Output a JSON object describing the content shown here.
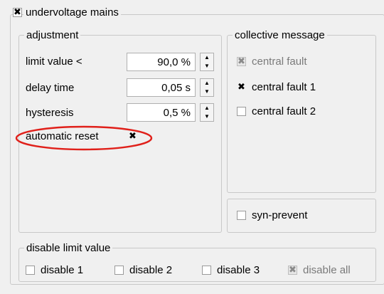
{
  "main_group": {
    "label": "undervoltage mains",
    "checked": true
  },
  "adjustment": {
    "label": "adjustment",
    "fields": [
      {
        "label": "limit value <",
        "value": "90,0 %"
      },
      {
        "label": "delay time",
        "value": "0,05 s"
      },
      {
        "label": "hysteresis",
        "value": "0,5 %"
      }
    ],
    "automatic_reset": {
      "label": "automatic reset",
      "checked": true
    }
  },
  "collective_message": {
    "label": "collective message",
    "items": [
      {
        "label": "central fault",
        "checked": true,
        "disabled": true
      },
      {
        "label": "central fault 1",
        "checked": true,
        "disabled": false
      },
      {
        "label": "central fault 2",
        "checked": false,
        "disabled": false
      }
    ]
  },
  "syn_prevent": {
    "label": "syn-prevent",
    "checked": false
  },
  "disable_limit": {
    "label": "disable limit value",
    "items": [
      {
        "label": "disable 1",
        "checked": false,
        "disabled": false
      },
      {
        "label": "disable 2",
        "checked": false,
        "disabled": false
      },
      {
        "label": "disable 3",
        "checked": false,
        "disabled": false
      },
      {
        "label": "disable all",
        "checked": true,
        "disabled": true
      }
    ]
  },
  "marks": {
    "check_glyph": "✖",
    "up_arrow": "▲",
    "down_arrow": "▼"
  },
  "colors": {
    "panel_bg": "#f0f0f0",
    "highlight": "#e0201a"
  }
}
